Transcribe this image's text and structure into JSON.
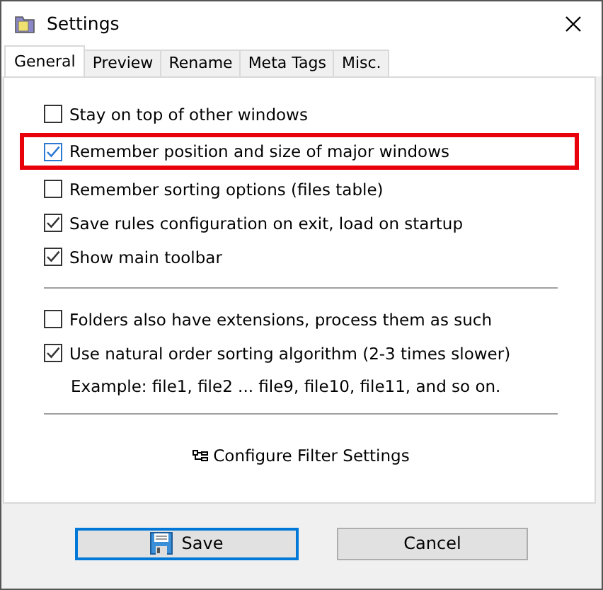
{
  "window": {
    "title": "Settings"
  },
  "tabs": [
    {
      "label": "General",
      "selected": true
    },
    {
      "label": "Preview",
      "selected": false
    },
    {
      "label": "Rename",
      "selected": false
    },
    {
      "label": "Meta Tags",
      "selected": false
    },
    {
      "label": "Misc.",
      "selected": false
    }
  ],
  "option_groups": [
    {
      "options": [
        {
          "label": "Stay on top of other windows",
          "checked": false,
          "highlighted": false
        },
        {
          "label": "Remember position and size of major windows",
          "checked": true,
          "highlighted": true
        },
        {
          "label": "Remember sorting options (files table)",
          "checked": false,
          "highlighted": false
        },
        {
          "label": "Save rules configuration on exit, load on startup",
          "checked": true,
          "highlighted": false
        },
        {
          "label": "Show main toolbar",
          "checked": true,
          "highlighted": false
        }
      ]
    },
    {
      "options": [
        {
          "label": "Folders also have extensions, process them as such",
          "checked": false,
          "highlighted": false
        },
        {
          "label": "Use natural order sorting algorithm (2-3 times slower)",
          "checked": true,
          "highlighted": false
        }
      ],
      "note": "Example: file1, file2 ... file9, file10, file11, and so on."
    }
  ],
  "filter_link": "Configure Filter Settings",
  "buttons": [
    {
      "label": "Save",
      "focused": true
    },
    {
      "label": "Cancel",
      "focused": false
    }
  ]
}
